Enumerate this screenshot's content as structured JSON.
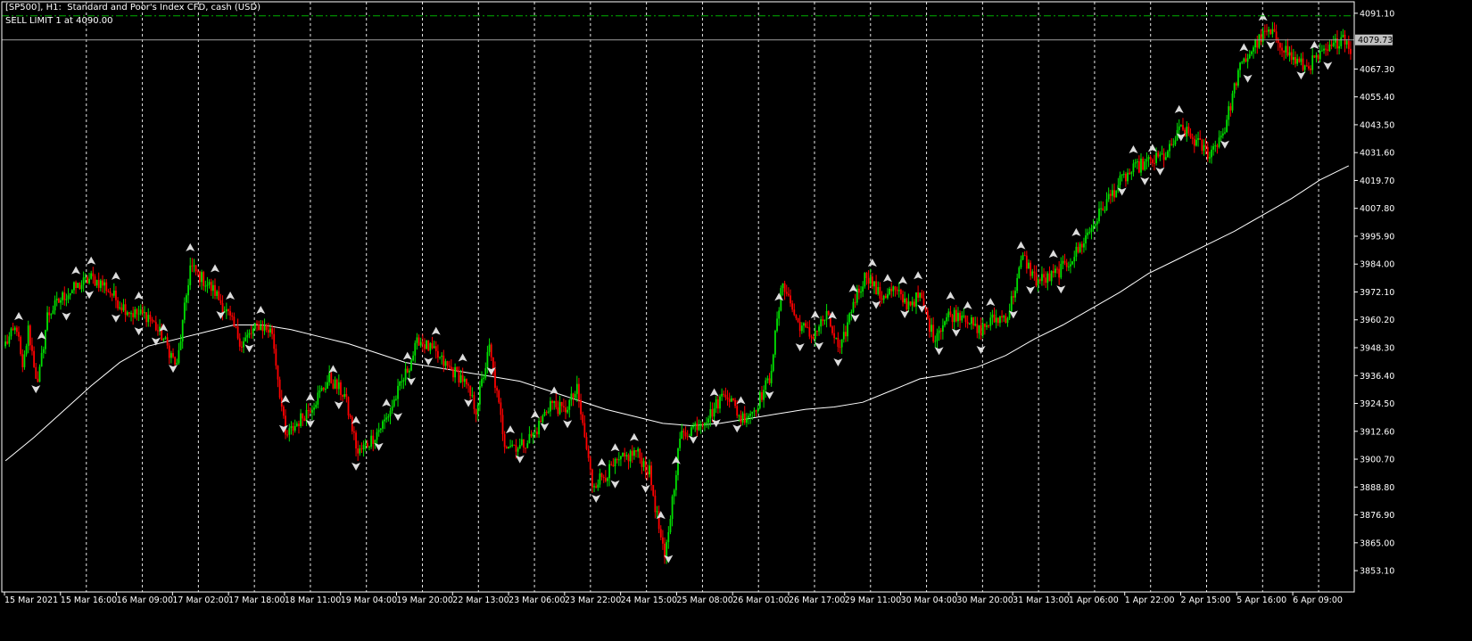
{
  "window": {
    "title": "[SP500], H1:  Standard and Poor's Index CFD, cash (USD)",
    "order_label": "SELL LIMIT 1 at 4090.00"
  },
  "colors": {
    "background": "#000000",
    "bull": "#00e000",
    "bear": "#ff0000",
    "wick": "#ffffff",
    "grid": "#ffffff",
    "ma_line": "#ffffff",
    "sell_limit_line": "#00b000",
    "bid_line": "#a0a0a0",
    "arrow": "#dcdcdc"
  },
  "chart_data": {
    "type": "candlestick",
    "symbol": "SP500",
    "timeframe": "H1",
    "ylim": [
      3844,
      4096
    ],
    "y_ticks": [
      "4091.10",
      "4079.73",
      "4067.30",
      "4055.40",
      "4043.50",
      "4031.60",
      "4019.70",
      "4007.80",
      "3995.90",
      "3984.00",
      "3972.10",
      "3960.20",
      "3948.30",
      "3936.40",
      "3924.50",
      "3912.60",
      "3900.70",
      "3888.80",
      "3876.90",
      "3865.00",
      "3853.10"
    ],
    "x_ticks": [
      "15 Mar 2021",
      "15 Mar 16:00",
      "16 Mar 09:00",
      "17 Mar 02:00",
      "17 Mar 18:00",
      "18 Mar 11:00",
      "19 Mar 04:00",
      "19 Mar 20:00",
      "22 Mar 13:00",
      "23 Mar 06:00",
      "23 Mar 22:00",
      "24 Mar 15:00",
      "25 Mar 08:00",
      "26 Mar 01:00",
      "26 Mar 17:00",
      "29 Mar 11:00",
      "30 Mar 04:00",
      "30 Mar 20:00",
      "31 Mar 13:00",
      "1 Apr 06:00",
      "1 Apr 22:00",
      "2 Apr 15:00",
      "5 Apr 16:00",
      "6 Apr 09:00"
    ],
    "grid": "vertical-dashed",
    "current_price": "4079.73",
    "sell_limit_price": 4090.0,
    "anchors": [
      [
        0,
        3950
      ],
      [
        6,
        3957
      ],
      [
        9,
        3938
      ],
      [
        12,
        3956
      ],
      [
        17,
        3932
      ],
      [
        22,
        3962
      ],
      [
        30,
        3970
      ],
      [
        37,
        3974
      ],
      [
        45,
        3978
      ],
      [
        52,
        3975
      ],
      [
        60,
        3967
      ],
      [
        67,
        3963
      ],
      [
        75,
        3962
      ],
      [
        83,
        3952
      ],
      [
        90,
        3940
      ],
      [
        97,
        3983
      ],
      [
        103,
        3978
      ],
      [
        110,
        3972
      ],
      [
        117,
        3962
      ],
      [
        124,
        3950
      ],
      [
        133,
        3958
      ],
      [
        140,
        3955
      ],
      [
        147,
        3910
      ],
      [
        155,
        3918
      ],
      [
        162,
        3925
      ],
      [
        170,
        3935
      ],
      [
        178,
        3928
      ],
      [
        185,
        3903
      ],
      [
        193,
        3910
      ],
      [
        200,
        3918
      ],
      [
        210,
        3937
      ],
      [
        217,
        3952
      ],
      [
        225,
        3946
      ],
      [
        232,
        3940
      ],
      [
        240,
        3935
      ],
      [
        247,
        3922
      ],
      [
        254,
        3948
      ],
      [
        262,
        3908
      ],
      [
        270,
        3906
      ],
      [
        278,
        3912
      ],
      [
        286,
        3925
      ],
      [
        293,
        3921
      ],
      [
        300,
        3930
      ],
      [
        308,
        3890
      ],
      [
        316,
        3895
      ],
      [
        323,
        3900
      ],
      [
        331,
        3904
      ],
      [
        338,
        3895
      ],
      [
        346,
        3857
      ],
      [
        354,
        3910
      ],
      [
        362,
        3915
      ],
      [
        370,
        3920
      ],
      [
        378,
        3930
      ],
      [
        386,
        3918
      ],
      [
        393,
        3922
      ],
      [
        401,
        3935
      ],
      [
        408,
        3977
      ],
      [
        415,
        3960
      ],
      [
        423,
        3953
      ],
      [
        431,
        3962
      ],
      [
        438,
        3946
      ],
      [
        445,
        3968
      ],
      [
        452,
        3980
      ],
      [
        459,
        3970
      ],
      [
        466,
        3973
      ],
      [
        473,
        3967
      ],
      [
        480,
        3970
      ],
      [
        487,
        3953
      ],
      [
        495,
        3962
      ],
      [
        503,
        3963
      ],
      [
        510,
        3955
      ],
      [
        518,
        3960
      ],
      [
        526,
        3962
      ],
      [
        534,
        3987
      ],
      [
        541,
        3977
      ],
      [
        548,
        3978
      ],
      [
        556,
        3983
      ],
      [
        563,
        3990
      ],
      [
        571,
        4001
      ],
      [
        579,
        4012
      ],
      [
        586,
        4020
      ],
      [
        595,
        4026
      ],
      [
        602,
        4028
      ],
      [
        610,
        4031
      ],
      [
        617,
        4042
      ],
      [
        625,
        4036
      ],
      [
        632,
        4031
      ],
      [
        640,
        4042
      ],
      [
        647,
        4066
      ],
      [
        655,
        4077
      ],
      [
        662,
        4083
      ],
      [
        668,
        4080
      ],
      [
        675,
        4072
      ],
      [
        682,
        4068
      ],
      [
        689,
        4072
      ],
      [
        696,
        4076
      ],
      [
        702,
        4082
      ],
      [
        706,
        4076
      ]
    ],
    "ma_points": [
      [
        0,
        3900
      ],
      [
        15,
        3910
      ],
      [
        30,
        3921
      ],
      [
        45,
        3932
      ],
      [
        60,
        3942
      ],
      [
        75,
        3949
      ],
      [
        90,
        3952
      ],
      [
        105,
        3955
      ],
      [
        120,
        3958
      ],
      [
        135,
        3958
      ],
      [
        150,
        3956
      ],
      [
        165,
        3953
      ],
      [
        180,
        3950
      ],
      [
        195,
        3946
      ],
      [
        210,
        3942
      ],
      [
        225,
        3940
      ],
      [
        240,
        3938
      ],
      [
        255,
        3936
      ],
      [
        270,
        3934
      ],
      [
        285,
        3930
      ],
      [
        300,
        3926
      ],
      [
        315,
        3922
      ],
      [
        330,
        3919
      ],
      [
        345,
        3916
      ],
      [
        360,
        3915
      ],
      [
        375,
        3916
      ],
      [
        390,
        3918
      ],
      [
        405,
        3920
      ],
      [
        420,
        3922
      ],
      [
        435,
        3923
      ],
      [
        450,
        3925
      ],
      [
        465,
        3930
      ],
      [
        480,
        3935
      ],
      [
        495,
        3937
      ],
      [
        510,
        3940
      ],
      [
        525,
        3945
      ],
      [
        540,
        3952
      ],
      [
        555,
        3958
      ],
      [
        570,
        3965
      ],
      [
        585,
        3972
      ],
      [
        600,
        3980
      ],
      [
        615,
        3986
      ],
      [
        630,
        3992
      ],
      [
        645,
        3998
      ],
      [
        660,
        4005
      ],
      [
        675,
        4012
      ],
      [
        690,
        4020
      ],
      [
        705,
        4026
      ]
    ],
    "fractal_up_bars": [
      7,
      19,
      37,
      45,
      58,
      70,
      83,
      97,
      110,
      118,
      134,
      147,
      160,
      172,
      184,
      200,
      211,
      226,
      240,
      265,
      278,
      288,
      313,
      320,
      330,
      344,
      352,
      372,
      386,
      406,
      425,
      434,
      445,
      455,
      463,
      471,
      479,
      496,
      505,
      517,
      533,
      550,
      562,
      592,
      602,
      616,
      650,
      660,
      687
    ],
    "fractal_down_bars": [
      16,
      32,
      44,
      58,
      70,
      79,
      88,
      113,
      128,
      146,
      160,
      175,
      184,
      196,
      206,
      213,
      222,
      243,
      255,
      270,
      283,
      295,
      310,
      320,
      336,
      348,
      361,
      373,
      384,
      401,
      417,
      427,
      437,
      446,
      457,
      472,
      481,
      490,
      499,
      512,
      529,
      538,
      554,
      586,
      598,
      606,
      617,
      640,
      652,
      664,
      680,
      694
    ]
  }
}
